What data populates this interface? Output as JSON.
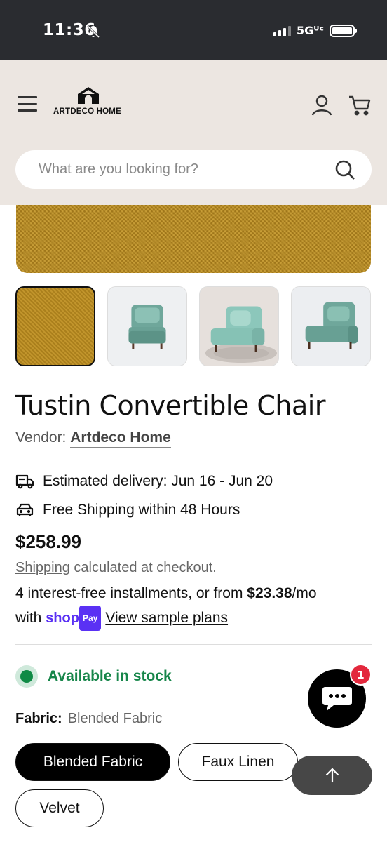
{
  "status_bar": {
    "time": "11:36",
    "network": "5Gᵁᶜ"
  },
  "header": {
    "logo_text": "ARTDECO HOME"
  },
  "search": {
    "placeholder": "What are you looking for?"
  },
  "product": {
    "title": "Tustin Convertible Chair",
    "vendor_label": "Vendor:",
    "vendor_name": "Artdeco Home",
    "delivery": "Estimated delivery: Jun 16 - Jun 20",
    "free_shipping": "Free Shipping within 48 Hours",
    "price": "$258.99",
    "shipping_link": "Shipping",
    "shipping_note": " calculated at checkout.",
    "installments_text": "4 interest-free installments, or from ",
    "installment_amount": "$23.38",
    "installment_suffix": "/mo",
    "with_text": "with ",
    "shop_text": "shop",
    "pay_text": "Pay",
    "view_plans": "View sample plans",
    "stock_status": "Available in stock",
    "fabric_label": "Fabric:",
    "fabric_selected": "Blended Fabric",
    "fabric_options": [
      "Blended Fabric",
      "Faux Linen",
      "Velvet"
    ]
  },
  "thumbnails": [
    "mustard fabric swatch",
    "chair front view",
    "chair on rug",
    "chair side view"
  ],
  "chat": {
    "badge_count": "1"
  },
  "colors": {
    "accent_green": "#17864a",
    "shop_pay": "#5a31f4",
    "header_bg": "#ece6e1",
    "badge_red": "#e3283d"
  }
}
